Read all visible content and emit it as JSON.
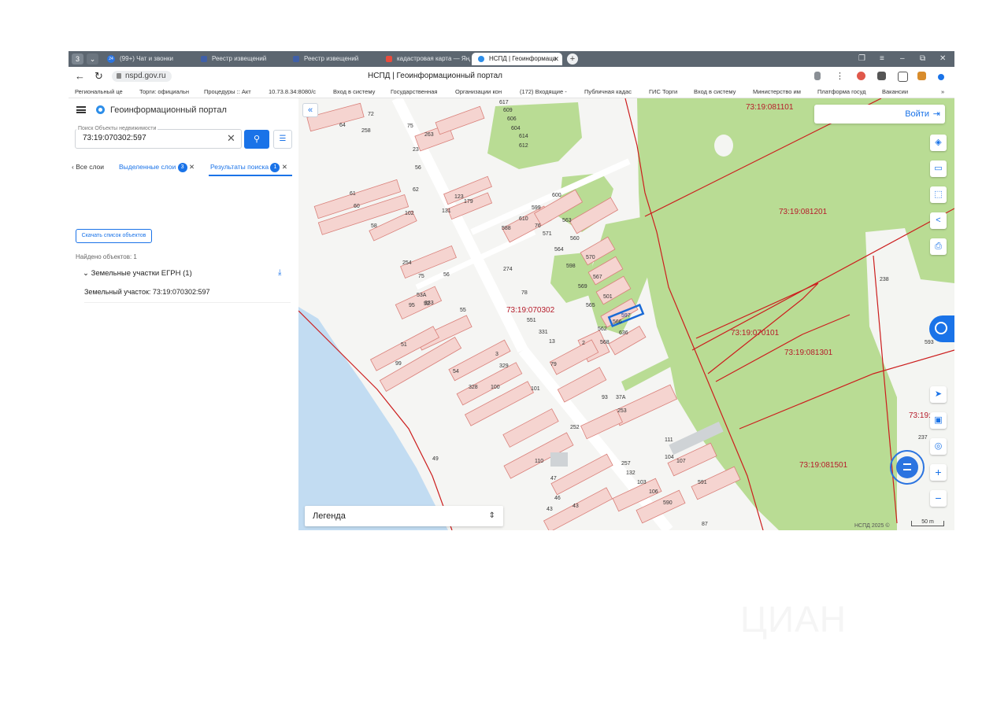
{
  "browser": {
    "tabs": [
      {
        "label": "(99+) Чат и звонки",
        "favicon_color": "#2b74e0"
      },
      {
        "label": "Реестр извещений",
        "favicon_color": "#3f5fa8"
      },
      {
        "label": "Реестр извещений",
        "favicon_color": "#3f5fa8"
      },
      {
        "label": "кадастровая карта — Янд",
        "favicon_color": "#e84c3d"
      },
      {
        "label": "НСПД | Геоинформаци",
        "favicon_color": "#2d8ee9",
        "active": true
      }
    ],
    "tab_bar_badge": "3",
    "tab_counter": "24",
    "url": "nspd.gov.ru",
    "page_title": "НСПД | Геоинформационный портал",
    "window_controls": [
      "❐",
      "≡",
      "–",
      "⧉",
      "✕"
    ],
    "bookmarks": [
      "Региональный це",
      "Торги: официальн",
      "Процедуры :: Акт",
      "10.73.8.34:8080/с",
      "Вход в систему",
      "Государственная",
      "Организации кон",
      "(172) Входящие -",
      "Публичная кадас",
      "ГИС Торги",
      "Вход в систему",
      "Министерство им",
      "Платформа госуд",
      "Вакансии",
      "»"
    ]
  },
  "sidebar": {
    "app_title": "Геоинформационный портал",
    "search_label": "Поиск Объекты недвижимости",
    "search_value": "73:19:070302:597",
    "tabs": {
      "all_layers": "Все слои",
      "selected_layers": "Выделенные слои",
      "selected_count": "3",
      "results": "Результаты поиска",
      "results_count": "1"
    },
    "download_button": "Скачать список объектов",
    "found_text": "Найдено объектов: 1",
    "group_label": "Земельные участки ЕГРН (1)",
    "result_item": "Земельный участок: 73:19:070302:597"
  },
  "map": {
    "login_label": "Войти",
    "legend_label": "Легенда",
    "copyright": "НСПД 2025 ©",
    "scale_label": "50 m",
    "colors": {
      "background": "#f5f5f3",
      "forest": "#b9dc94",
      "parcel_fill": "#f5d4d0",
      "parcel_stroke": "#d9807a",
      "building": "#e8dca0",
      "water": "#c2dcf2",
      "boundary": "#cc1d1d",
      "selected": "#1a6ad6"
    },
    "quarter_labels": [
      "73:19:081101",
      "73:19:081201",
      "73:19:070302",
      "73:19:070101",
      "73:19:081301",
      "73:19:081501",
      "73:19:0"
    ],
    "selected_parcel": "597",
    "parcel_numbers": [
      "617",
      "609",
      "606",
      "604",
      "614",
      "612",
      "64",
      "72",
      "258",
      "75",
      "263",
      "23",
      "56",
      "62",
      "61",
      "60",
      "123",
      "179",
      "131",
      "102",
      "58",
      "600",
      "599",
      "610",
      "588",
      "76",
      "563",
      "571",
      "560",
      "564",
      "570",
      "598",
      "567",
      "569",
      "501",
      "565",
      "566",
      "562",
      "636",
      "568",
      "254",
      "75",
      "56",
      "274",
      "78",
      "53А",
      "52",
      "333",
      "95",
      "55",
      "51",
      "99",
      "54",
      "3",
      "329",
      "328",
      "100",
      "101",
      "551",
      "331",
      "13",
      "79",
      "2",
      "93",
      "253",
      "252",
      "37А",
      "49",
      "110",
      "47",
      "46",
      "43",
      "43",
      "257",
      "132",
      "103",
      "106",
      "590",
      "591",
      "104",
      "107",
      "111",
      "238",
      "593",
      "237",
      "87"
    ]
  }
}
